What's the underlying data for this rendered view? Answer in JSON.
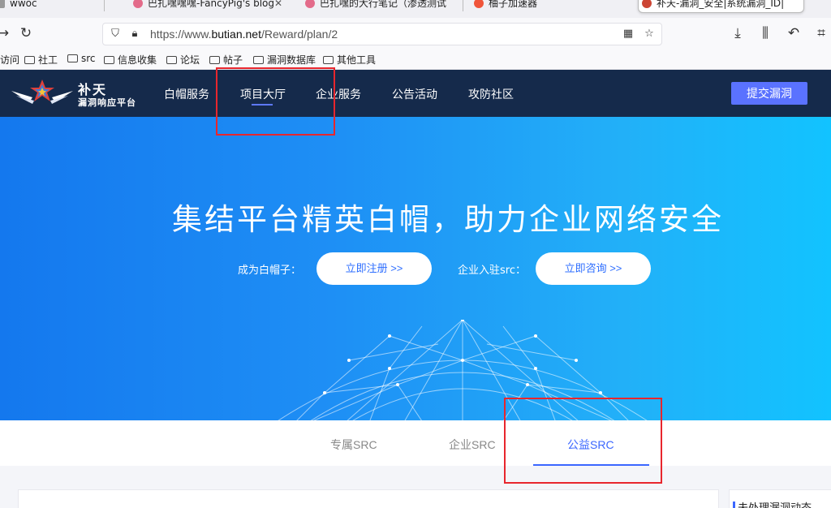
{
  "browser": {
    "tabs": [
      {
        "title": "wwoc"
      },
      {
        "title": "巴扎嘿嘿嘿-FancyPig's blog"
      },
      {
        "title": "巴扎嘿的大行笔记（渗透测试"
      },
      {
        "title": "柚子加速器"
      },
      {
        "title": "补天-漏洞_安全|系统漏洞_ID|"
      }
    ],
    "url_prefix": "https://www.",
    "url_domain": "butian.net",
    "url_path": "/Reward/plan/2",
    "bookmarks": [
      {
        "label": "访问"
      },
      {
        "label": "社工"
      },
      {
        "label": "src"
      },
      {
        "label": "信息收集"
      },
      {
        "label": "论坛"
      },
      {
        "label": "帖子"
      },
      {
        "label": "漏洞数据库"
      },
      {
        "label": "其他工具"
      }
    ]
  },
  "site": {
    "logo_name": "补天",
    "logo_sub": "漏洞响应平台",
    "nav": [
      {
        "label": "白帽服务"
      },
      {
        "label": "项目大厅"
      },
      {
        "label": "企业服务"
      },
      {
        "label": "公告活动"
      },
      {
        "label": "攻防社区"
      }
    ],
    "submit_label": "提交漏洞"
  },
  "hero": {
    "title": "集结平台精英白帽，助力企业网络安全",
    "whitehat_label": "成为白帽子：",
    "register_btn": "立即注册 >>",
    "enterprise_label": "企业入驻src：",
    "consult_btn": "立即咨询 >>"
  },
  "categories": [
    {
      "label": "专属SRC"
    },
    {
      "label": "企业SRC"
    },
    {
      "label": "公益SRC"
    }
  ],
  "sidebar": {
    "title": "未处理漏洞动态"
  },
  "colors": {
    "nav_bg": "#152a4b",
    "accent": "#3b67ff",
    "annotation_red": "#e8262d"
  }
}
